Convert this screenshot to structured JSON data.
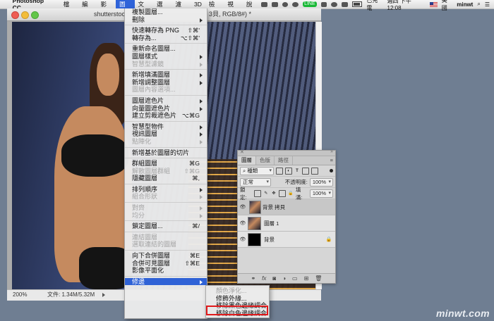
{
  "menubar": {
    "app_name": "Photoshop CC",
    "items": [
      "檔案",
      "編輯",
      "影像",
      "圖層",
      "文字",
      "選取",
      "濾鏡",
      "3D",
      "檢視",
      "視窗",
      "說明"
    ],
    "active_index": 3,
    "status": {
      "line": "LINE",
      "battery_text": "已充電",
      "time": "週四 下午 12:08",
      "input_method": "美國",
      "user": "minwt"
    }
  },
  "document": {
    "title_left": "shutterstoc",
    "title_right": "3貝, RGB/8#) *",
    "zoom": "200%",
    "file_info": "文件: 1.34M/5.32M"
  },
  "layer_menu": {
    "items": [
      {
        "label": "複製圖層...",
        "shortcut": "",
        "submenu": false,
        "disabled": false,
        "sep_before": false
      },
      {
        "label": "刪除",
        "shortcut": "",
        "submenu": true,
        "disabled": false,
        "sep_before": false
      },
      {
        "label": "快速轉存為 PNG",
        "shortcut": "⇧⌘'",
        "submenu": false,
        "disabled": false,
        "sep_before": true
      },
      {
        "label": "轉存為...",
        "shortcut": "⌥⇧⌘'",
        "submenu": false,
        "disabled": false,
        "sep_before": false
      },
      {
        "label": "重新命名圖層...",
        "shortcut": "",
        "submenu": false,
        "disabled": false,
        "sep_before": true
      },
      {
        "label": "圖層樣式",
        "shortcut": "",
        "submenu": true,
        "disabled": false,
        "sep_before": false
      },
      {
        "label": "智慧型濾鏡",
        "shortcut": "",
        "submenu": true,
        "disabled": true,
        "sep_before": false
      },
      {
        "label": "新增填滿圖層",
        "shortcut": "",
        "submenu": true,
        "disabled": false,
        "sep_before": true
      },
      {
        "label": "新增調整圖層",
        "shortcut": "",
        "submenu": true,
        "disabled": false,
        "sep_before": false
      },
      {
        "label": "圖層內容選項...",
        "shortcut": "",
        "submenu": false,
        "disabled": true,
        "sep_before": false
      },
      {
        "label": "圖層遮色片",
        "shortcut": "",
        "submenu": true,
        "disabled": false,
        "sep_before": true
      },
      {
        "label": "向量圖遮色片",
        "shortcut": "",
        "submenu": true,
        "disabled": false,
        "sep_before": false
      },
      {
        "label": "建立剪裁遮色片",
        "shortcut": "⌥⌘G",
        "submenu": false,
        "disabled": false,
        "sep_before": false
      },
      {
        "label": "智慧型物件",
        "shortcut": "",
        "submenu": true,
        "disabled": false,
        "sep_before": true
      },
      {
        "label": "視訊圖層",
        "shortcut": "",
        "submenu": true,
        "disabled": false,
        "sep_before": false
      },
      {
        "label": "點陣化",
        "shortcut": "",
        "submenu": true,
        "disabled": true,
        "sep_before": false
      },
      {
        "label": "新增基於圖層的切片",
        "shortcut": "",
        "submenu": false,
        "disabled": false,
        "sep_before": true
      },
      {
        "label": "群組圖層",
        "shortcut": "⌘G",
        "submenu": false,
        "disabled": false,
        "sep_before": true
      },
      {
        "label": "解散圖層群組",
        "shortcut": "⇧⌘G",
        "submenu": false,
        "disabled": true,
        "sep_before": false
      },
      {
        "label": "隱藏圖層",
        "shortcut": "⌘,",
        "submenu": false,
        "disabled": false,
        "sep_before": false
      },
      {
        "label": "排列順序",
        "shortcut": "",
        "submenu": true,
        "disabled": false,
        "sep_before": true
      },
      {
        "label": "組合形狀",
        "shortcut": "",
        "submenu": true,
        "disabled": true,
        "sep_before": false
      },
      {
        "label": "對齊",
        "shortcut": "",
        "submenu": true,
        "disabled": true,
        "sep_before": true
      },
      {
        "label": "均分",
        "shortcut": "",
        "submenu": true,
        "disabled": true,
        "sep_before": false
      },
      {
        "label": "鎖定圖層...",
        "shortcut": "⌘/",
        "submenu": false,
        "disabled": false,
        "sep_before": true
      },
      {
        "label": "連結圖層",
        "shortcut": "",
        "submenu": false,
        "disabled": true,
        "sep_before": true
      },
      {
        "label": "選取連結的圖層",
        "shortcut": "",
        "submenu": false,
        "disabled": true,
        "sep_before": false
      },
      {
        "label": "向下合併圖層",
        "shortcut": "⌘E",
        "submenu": false,
        "disabled": false,
        "sep_before": true
      },
      {
        "label": "合併可見圖層",
        "shortcut": "⇧⌘E",
        "submenu": false,
        "disabled": false,
        "sep_before": false
      },
      {
        "label": "影像平面化",
        "shortcut": "",
        "submenu": false,
        "disabled": false,
        "sep_before": false
      },
      {
        "label": "修邊",
        "shortcut": "",
        "submenu": true,
        "disabled": false,
        "sep_before": true,
        "highlight": true
      }
    ]
  },
  "matting_submenu": {
    "items": [
      {
        "label": "顏色淨化...",
        "disabled": true
      },
      {
        "label": "修飾外緣...",
        "disabled": false
      },
      {
        "label": "移除黑色邊緣調合",
        "disabled": false
      },
      {
        "label": "移除白色邊緣調合",
        "disabled": false,
        "boxed": true
      }
    ]
  },
  "layers_panel": {
    "tabs": [
      "圖層",
      "色版",
      "路徑"
    ],
    "filter_kind": "種類",
    "blend_mode": "正常",
    "opacity_label": "不透明度:",
    "opacity_value": "100%",
    "lock_label": "鎖定:",
    "fill_label": "填滿:",
    "fill_value": "100%",
    "layers": [
      {
        "name": "背景 拷貝",
        "selected": true,
        "locked": false,
        "thumb": "photo"
      },
      {
        "name": "圖層 1",
        "selected": false,
        "locked": false,
        "thumb": "photo"
      },
      {
        "name": "背景",
        "selected": false,
        "locked": true,
        "thumb": "black"
      }
    ],
    "bottom_icons": [
      "link-icon",
      "fx-icon",
      "mask-icon",
      "adjustment-icon",
      "folder-icon",
      "new-layer-icon",
      "trash-icon"
    ]
  },
  "watermark": "minwt.com"
}
